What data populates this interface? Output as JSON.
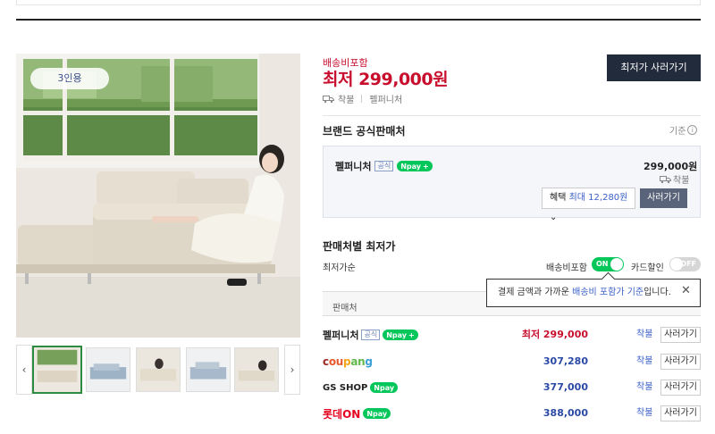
{
  "product": {
    "badge": "3인용",
    "shipping_label": "배송비포함",
    "lowest_price": "최저 299,000원",
    "ship_text": "착불",
    "seller_name": "펠퍼니처",
    "buy_lowest_label": "최저가 사러가기"
  },
  "official": {
    "title": "브랜드 공식판매처",
    "criteria": "기준",
    "seller": "펠퍼니처",
    "tag": "공식",
    "npay": "pay",
    "price": "299,000원",
    "ship": "착불",
    "benefit_prefix": "혜택",
    "benefit_value": "최대 12,280원",
    "buy_label": "사러가기"
  },
  "lowest": {
    "title": "판매처별 최저가",
    "sort_label": "최저가순",
    "toggle_shipping_label": "배송비포함",
    "toggle_shipping_state": "ON",
    "toggle_card_label": "카드할인",
    "toggle_card_state": "OFF",
    "column_header": "판매처",
    "tooltip_prefix": "결제 금액과 가까운 ",
    "tooltip_highlight": "배송비 포함가 기준",
    "tooltip_suffix": "입니다.",
    "rows": [
      {
        "seller": "펠퍼니처",
        "tag": "공식",
        "price": "최저 299,000",
        "ship": "착불",
        "buy": "사러가기"
      },
      {
        "seller": "coupang",
        "price": "307,280",
        "ship": "착불",
        "buy": "사러가기"
      },
      {
        "seller": "GS SHOP",
        "price": "377,000",
        "ship": "착불",
        "buy": "사러가기"
      },
      {
        "seller": "롯데ON",
        "price": "388,000",
        "ship": "착불",
        "buy": "사러가기"
      }
    ]
  },
  "colors": {
    "accent_red": "#c8102e",
    "npay_green": "#03c75a",
    "dark_button": "#222b3b",
    "link_blue": "#3a5fc8"
  }
}
